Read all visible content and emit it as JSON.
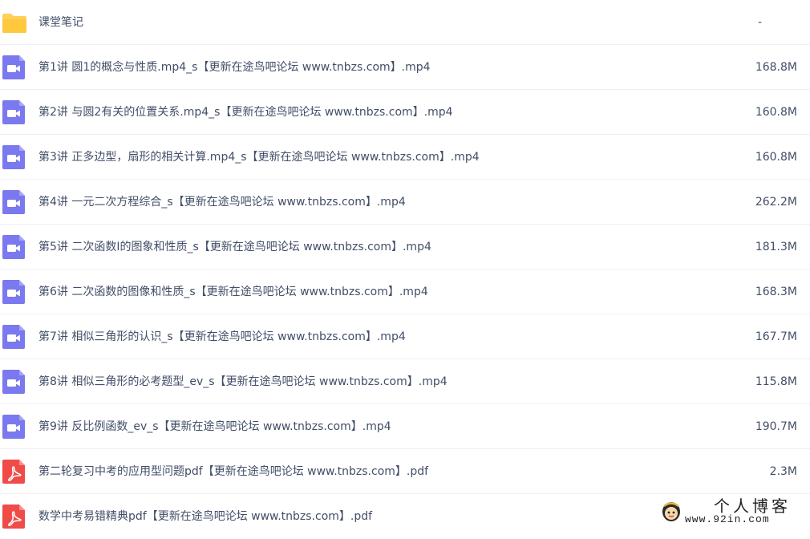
{
  "colors": {
    "folder": "#ffd15c",
    "video": "#7a79ef",
    "pdf": "#f04b48",
    "text": "#424e67",
    "divider": "#eef0f4"
  },
  "files": [
    {
      "type": "folder",
      "icon": "folder-icon",
      "name": "课堂笔记",
      "size": "-"
    },
    {
      "type": "video",
      "icon": "video-file-icon",
      "name": "第1讲 圆1的概念与性质.mp4_s【更新在途鸟吧论坛 www.tnbzs.com】.mp4",
      "size": "168.8M"
    },
    {
      "type": "video",
      "icon": "video-file-icon",
      "name": "第2讲 与圆2有关的位置关系.mp4_s【更新在途鸟吧论坛 www.tnbzs.com】.mp4",
      "size": "160.8M"
    },
    {
      "type": "video",
      "icon": "video-file-icon",
      "name": "第3讲 正多边型，扇形的相关计算.mp4_s【更新在途鸟吧论坛 www.tnbzs.com】.mp4",
      "size": "160.8M"
    },
    {
      "type": "video",
      "icon": "video-file-icon",
      "name": "第4讲 一元二次方程综合_s【更新在途鸟吧论坛 www.tnbzs.com】.mp4",
      "size": "262.2M"
    },
    {
      "type": "video",
      "icon": "video-file-icon",
      "name": "第5讲 二次函数I的图象和性质_s【更新在途鸟吧论坛 www.tnbzs.com】.mp4",
      "size": "181.3M"
    },
    {
      "type": "video",
      "icon": "video-file-icon",
      "name": "第6讲 二次函数的图像和性质_s【更新在途鸟吧论坛 www.tnbzs.com】.mp4",
      "size": "168.3M"
    },
    {
      "type": "video",
      "icon": "video-file-icon",
      "name": "第7讲 相似三角形的认识_s【更新在途鸟吧论坛 www.tnbzs.com】.mp4",
      "size": "167.7M"
    },
    {
      "type": "video",
      "icon": "video-file-icon",
      "name": "第8讲 相似三角形的必考题型_ev_s【更新在途鸟吧论坛 www.tnbzs.com】.mp4",
      "size": "115.8M"
    },
    {
      "type": "video",
      "icon": "video-file-icon",
      "name": "第9讲 反比例函数_ev_s【更新在途鸟吧论坛 www.tnbzs.com】.mp4",
      "size": "190.7M"
    },
    {
      "type": "pdf",
      "icon": "pdf-file-icon",
      "name": "第二轮复习中考的应用型问题pdf【更新在途鸟吧论坛 www.tnbzs.com】.pdf",
      "size": "2.3M"
    },
    {
      "type": "pdf",
      "icon": "pdf-file-icon",
      "name": "数学中考易错精典pdf【更新在途鸟吧论坛 www.tnbzs.com】.pdf",
      "size": ""
    }
  ],
  "watermark": {
    "title": "个人博客",
    "url": "www.92in.com"
  }
}
